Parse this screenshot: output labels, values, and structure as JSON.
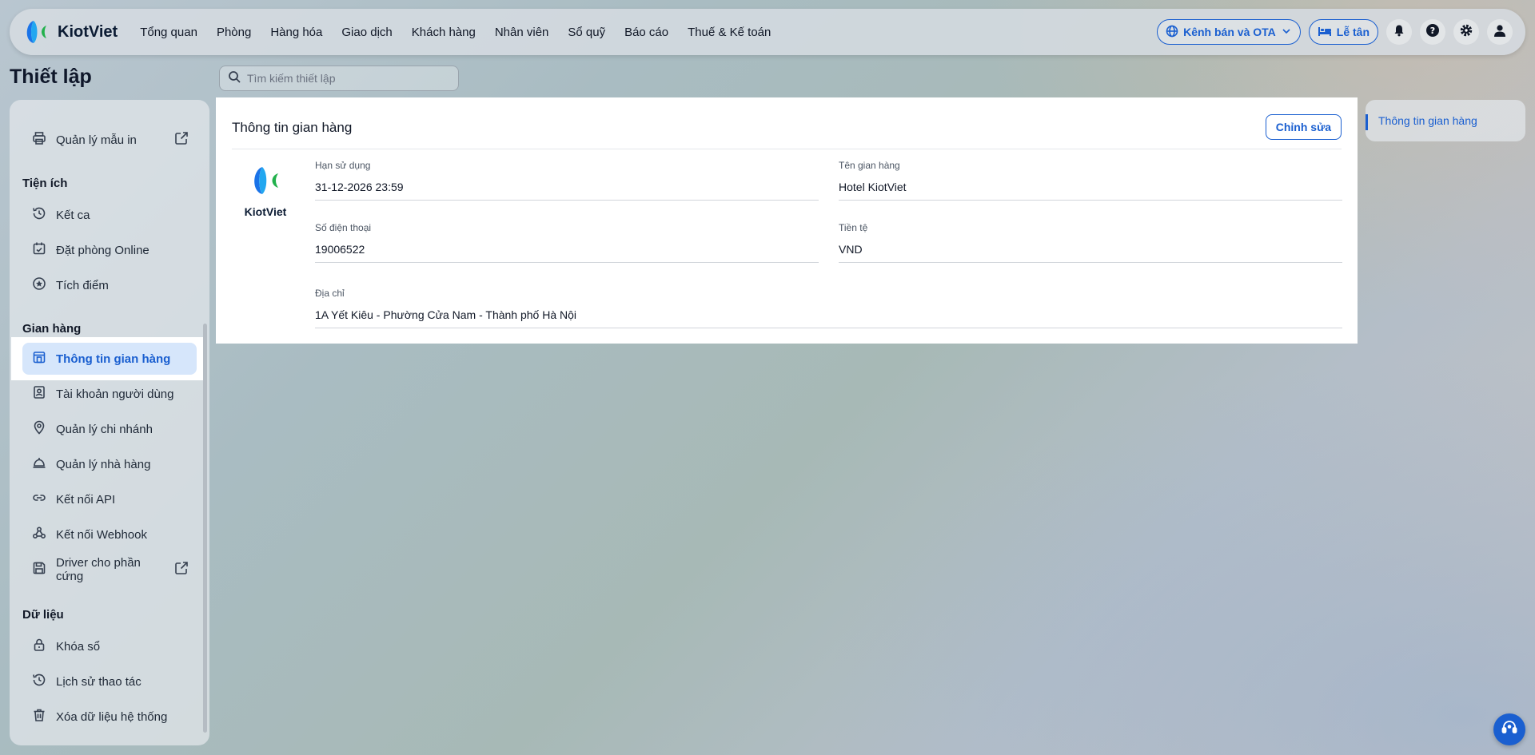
{
  "app": {
    "name": "KiotViet"
  },
  "nav": {
    "items": [
      "Tổng quan",
      "Phòng",
      "Hàng hóa",
      "Giao dịch",
      "Khách hàng",
      "Nhân viên",
      "Sổ quỹ",
      "Báo cáo",
      "Thuế & Kế toán"
    ],
    "channel_label": "Kênh bán và OTA",
    "reception_label": "Lễ tân"
  },
  "page": {
    "title": "Thiết lập",
    "search_placeholder": "Tìm kiếm thiết lập"
  },
  "sidebar": {
    "print_templates": "Quản lý mẫu in",
    "sections": {
      "utilities": "Tiện ích",
      "store": "Gian hàng",
      "data": "Dữ liệu"
    },
    "utilities": [
      "Kết ca",
      "Đặt phòng Online",
      "Tích điểm"
    ],
    "store": [
      "Thông tin gian hàng",
      "Tài khoản người dùng",
      "Quản lý chi nhánh",
      "Quản lý nhà hàng",
      "Kết nối API",
      "Kết nối Webhook",
      "Driver cho phần cứng"
    ],
    "data": [
      "Khóa sổ",
      "Lịch sử thao tác",
      "Xóa dữ liệu hệ thống"
    ]
  },
  "store_info": {
    "title": "Thông tin gian hàng",
    "edit_label": "Chỉnh sửa",
    "logo_text": "KiotViet",
    "fields": {
      "expiry_label": "Hạn sử dụng",
      "expiry_value": "31-12-2026 23:59",
      "name_label": "Tên gian hàng",
      "name_value": "Hotel KiotViet",
      "phone_label": "Số điện thoại",
      "phone_value": "19006522",
      "currency_label": "Tiền tệ",
      "currency_value": "VND",
      "address_label": "Địa chỉ",
      "address_value": "1A Yết Kiêu - Phường Cửa Nam - Thành phố Hà Nội"
    }
  },
  "right_nav": {
    "label": "Thông tin gian hàng"
  },
  "colors": {
    "accent": "#1a5fd0",
    "active_bg": "#d6e6fb"
  }
}
